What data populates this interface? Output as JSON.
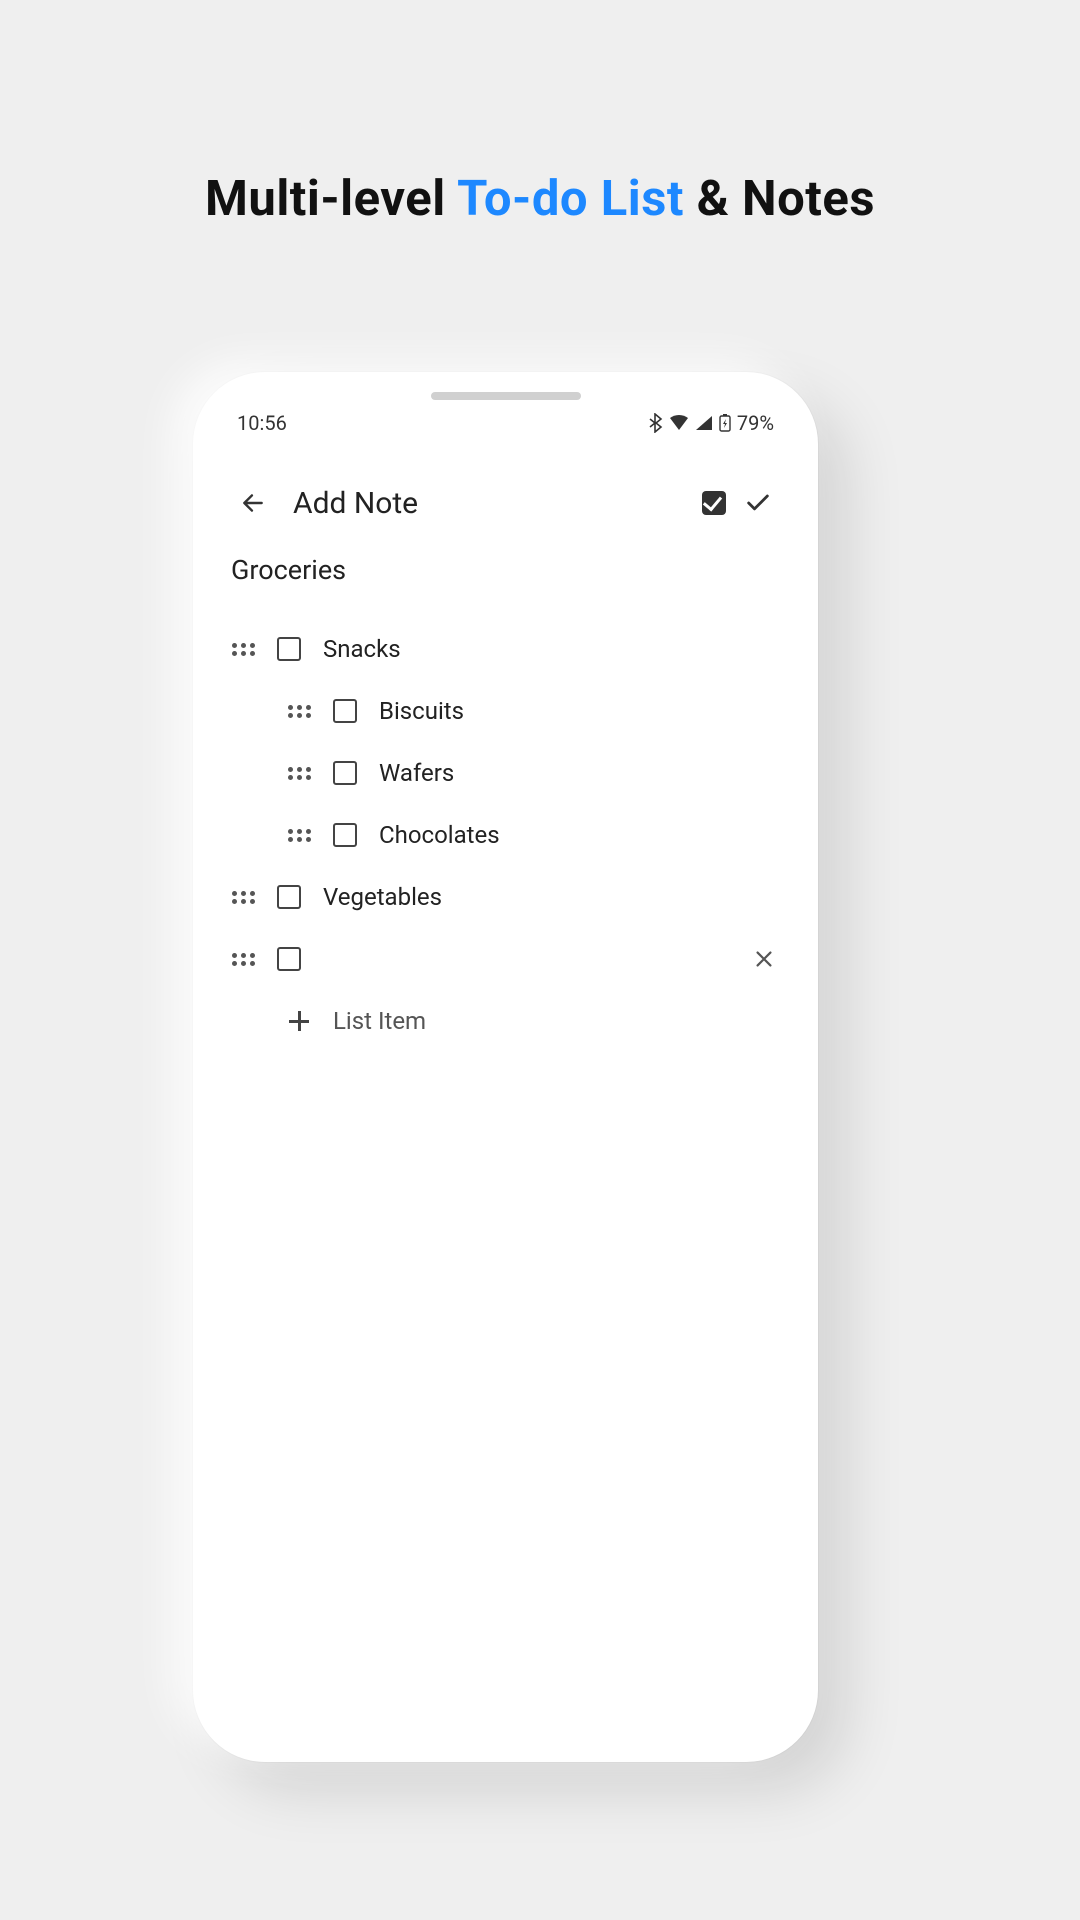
{
  "headline": {
    "pre": "Multi-level ",
    "accent": "To-do List",
    "post": " & Notes"
  },
  "status": {
    "time": "10:56",
    "battery": "79%"
  },
  "appbar": {
    "title": "Add Note"
  },
  "note": {
    "title": "Groceries",
    "items": [
      {
        "label": "Snacks",
        "level": 0,
        "checked": false
      },
      {
        "label": "Biscuits",
        "level": 1,
        "checked": false
      },
      {
        "label": "Wafers",
        "level": 1,
        "checked": false
      },
      {
        "label": "Chocolates",
        "level": 1,
        "checked": false
      },
      {
        "label": "Vegetables",
        "level": 0,
        "checked": false
      },
      {
        "label": "",
        "level": 0,
        "checked": false,
        "removable": true
      }
    ],
    "add_label": "List Item"
  }
}
